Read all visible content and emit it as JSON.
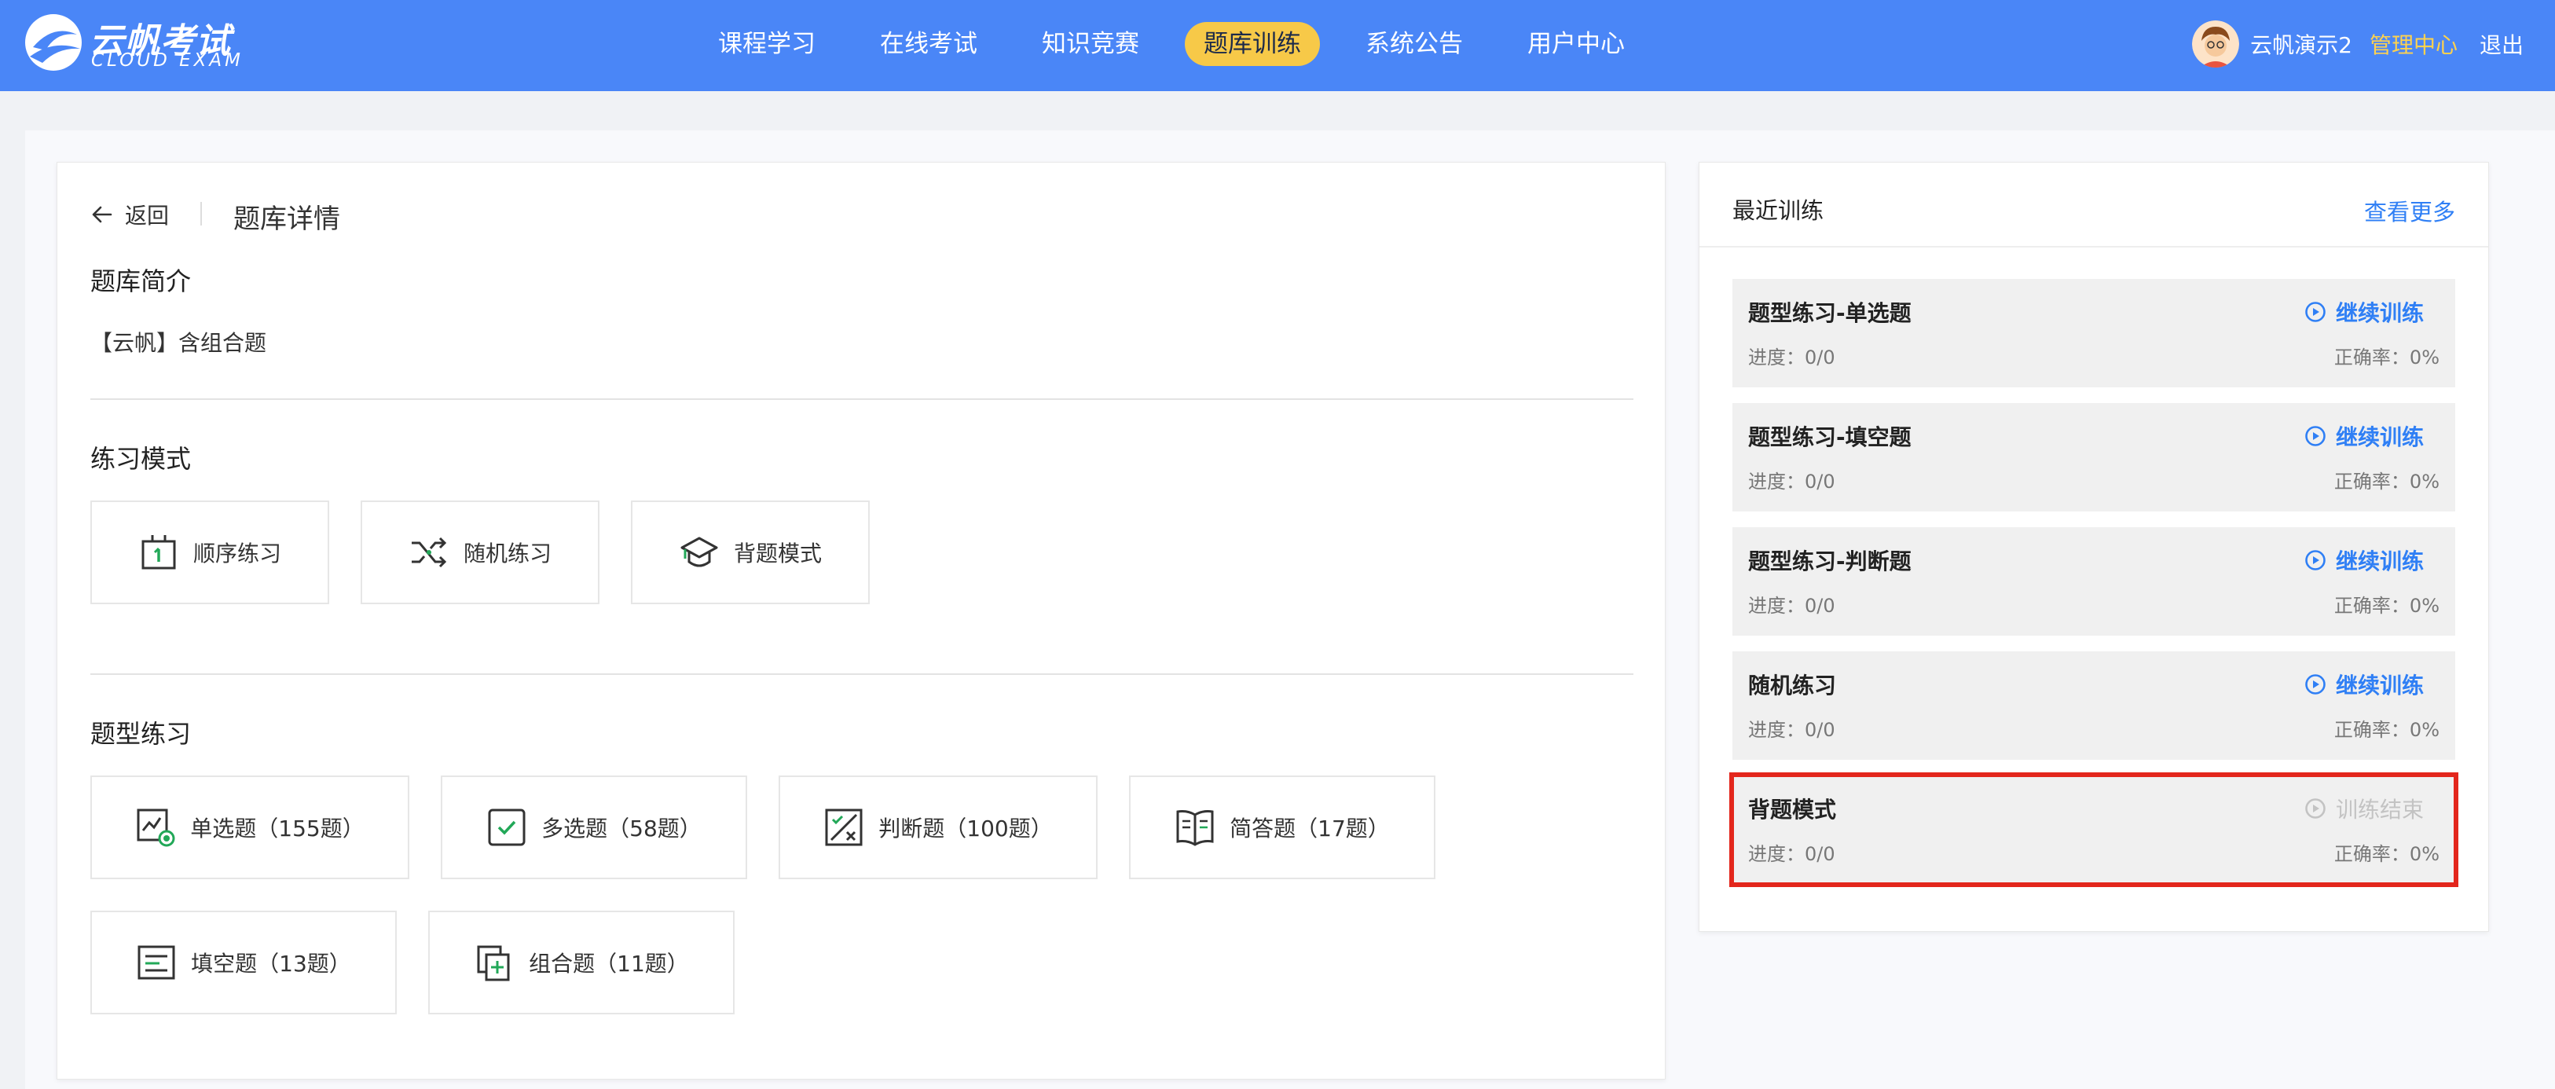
{
  "brand": {
    "name_cn": "云帆考试",
    "name_en": "CLOUD EXAM"
  },
  "nav": {
    "items": [
      {
        "label": "课程学习"
      },
      {
        "label": "在线考试"
      },
      {
        "label": "知识竞赛"
      },
      {
        "label": "题库训练"
      },
      {
        "label": "系统公告"
      },
      {
        "label": "用户中心"
      }
    ],
    "active": "题库训练"
  },
  "user": {
    "name": "云帆演示2",
    "admin": "管理中心",
    "logout": "退出"
  },
  "detail": {
    "back_label": "返回",
    "page_title": "题库详情",
    "intro_title": "题库简介",
    "intro_text": "【云帆】含组合题",
    "modes_title": "练习模式",
    "modes": [
      {
        "label": "顺序练习",
        "icon": "sequence-icon"
      },
      {
        "label": "随机练习",
        "icon": "shuffle-icon"
      },
      {
        "label": "背题模式",
        "icon": "graduation-cap-icon"
      }
    ],
    "types_title": "题型练习",
    "types": [
      {
        "label": "单选题（155题）",
        "icon": "single-choice-icon"
      },
      {
        "label": "多选题（58题）",
        "icon": "multi-choice-icon"
      },
      {
        "label": "判断题（100题）",
        "icon": "true-false-icon"
      },
      {
        "label": "简答题（17题）",
        "icon": "open-book-icon"
      },
      {
        "label": "填空题（13题）",
        "icon": "fill-blank-icon"
      },
      {
        "label": "组合题（11题）",
        "icon": "combined-icon"
      }
    ]
  },
  "recent": {
    "title": "最近训练",
    "more": "查看更多",
    "items": [
      {
        "name": "题型练习-单选题",
        "action": "继续训练",
        "progress": "进度：0/0",
        "rate": "正确率：0%"
      },
      {
        "name": "题型练习-填空题",
        "action": "继续训练",
        "progress": "进度：0/0",
        "rate": "正确率：0%"
      },
      {
        "name": "题型练习-判断题",
        "action": "继续训练",
        "progress": "进度：0/0",
        "rate": "正确率：0%"
      },
      {
        "name": "随机练习",
        "action": "继续训练",
        "progress": "进度：0/0",
        "rate": "正确率：0%"
      },
      {
        "name": "背题模式",
        "action": "训练结束",
        "progress": "进度：0/0",
        "rate": "正确率：0%"
      }
    ]
  },
  "colors": {
    "header": "#4a86f7",
    "active_nav": "#f7c948",
    "accent": "#2f7ff5",
    "highlight": "#e3261c"
  }
}
